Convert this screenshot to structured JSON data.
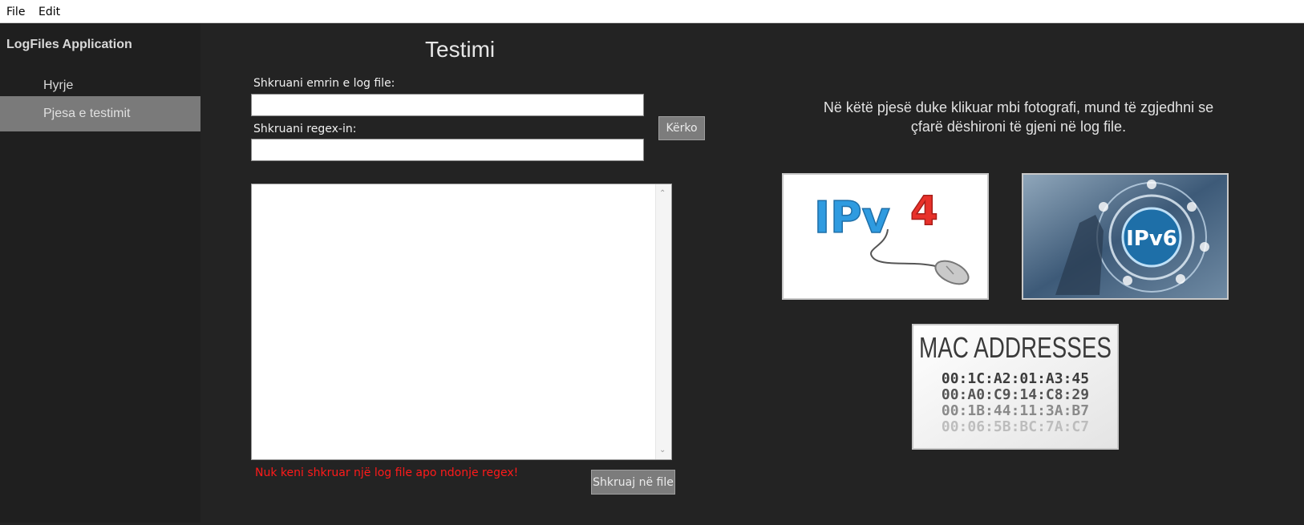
{
  "menubar": {
    "file": "File",
    "edit": "Edit"
  },
  "sidebar": {
    "title": "LogFiles Application",
    "items": [
      {
        "label": "Hyrje",
        "active": false
      },
      {
        "label": "Pjesa e testimit",
        "active": true
      }
    ]
  },
  "main": {
    "title": "Testimi",
    "log_label": "Shkruani emrin e log file:",
    "log_value": "",
    "regex_label": "Shkruani regex-in:",
    "regex_value": "",
    "search_button": "Kërko",
    "output_value": "",
    "error_message": "Nuk keni shkruar një log file apo ndonje regex!",
    "write_button": "Shkruaj në file"
  },
  "right": {
    "info": "Në këtë pjesë duke klikuar mbi fotografi, mund të zgjedhni se çfarë dëshironi të gjeni në log file.",
    "ipv4_text": "IPv",
    "ipv4_digit": "4",
    "ipv6_text": "IPv6",
    "mac_title": "MAC ADDRESSES",
    "mac_list": [
      "00:1C:A2:01:A3:45",
      "00:A0:C9:14:C8:29",
      "00:1B:44:11:3A:B7",
      "00:06:5B:BC:7A:C7"
    ]
  },
  "colors": {
    "background": "#232323",
    "sidebar": "#1f1f1f",
    "active_item": "#7a7a7a",
    "error": "#ff1a1a",
    "ipv4_blue": "#2f9be0",
    "ipv4_red": "#e8312a"
  }
}
